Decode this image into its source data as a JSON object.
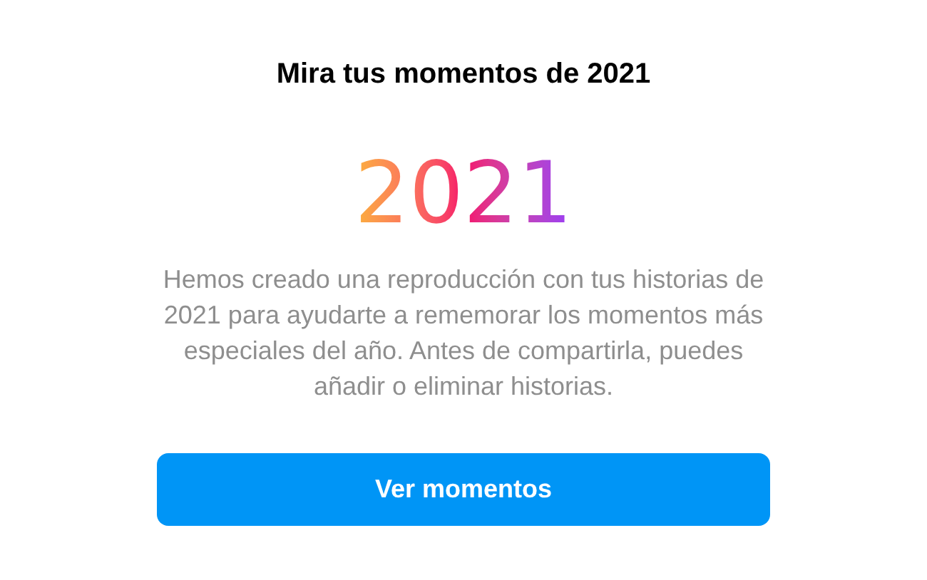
{
  "title": "Mira tus momentos de 2021",
  "year_logo": "2021",
  "description": "Hemos creado una reproducción con tus historias de 2021 para ayudarte a rememorar los momentos más especiales del año. Antes de compartirla, puedes añadir o eliminar historias.",
  "button": {
    "label": "Ver momentos"
  }
}
